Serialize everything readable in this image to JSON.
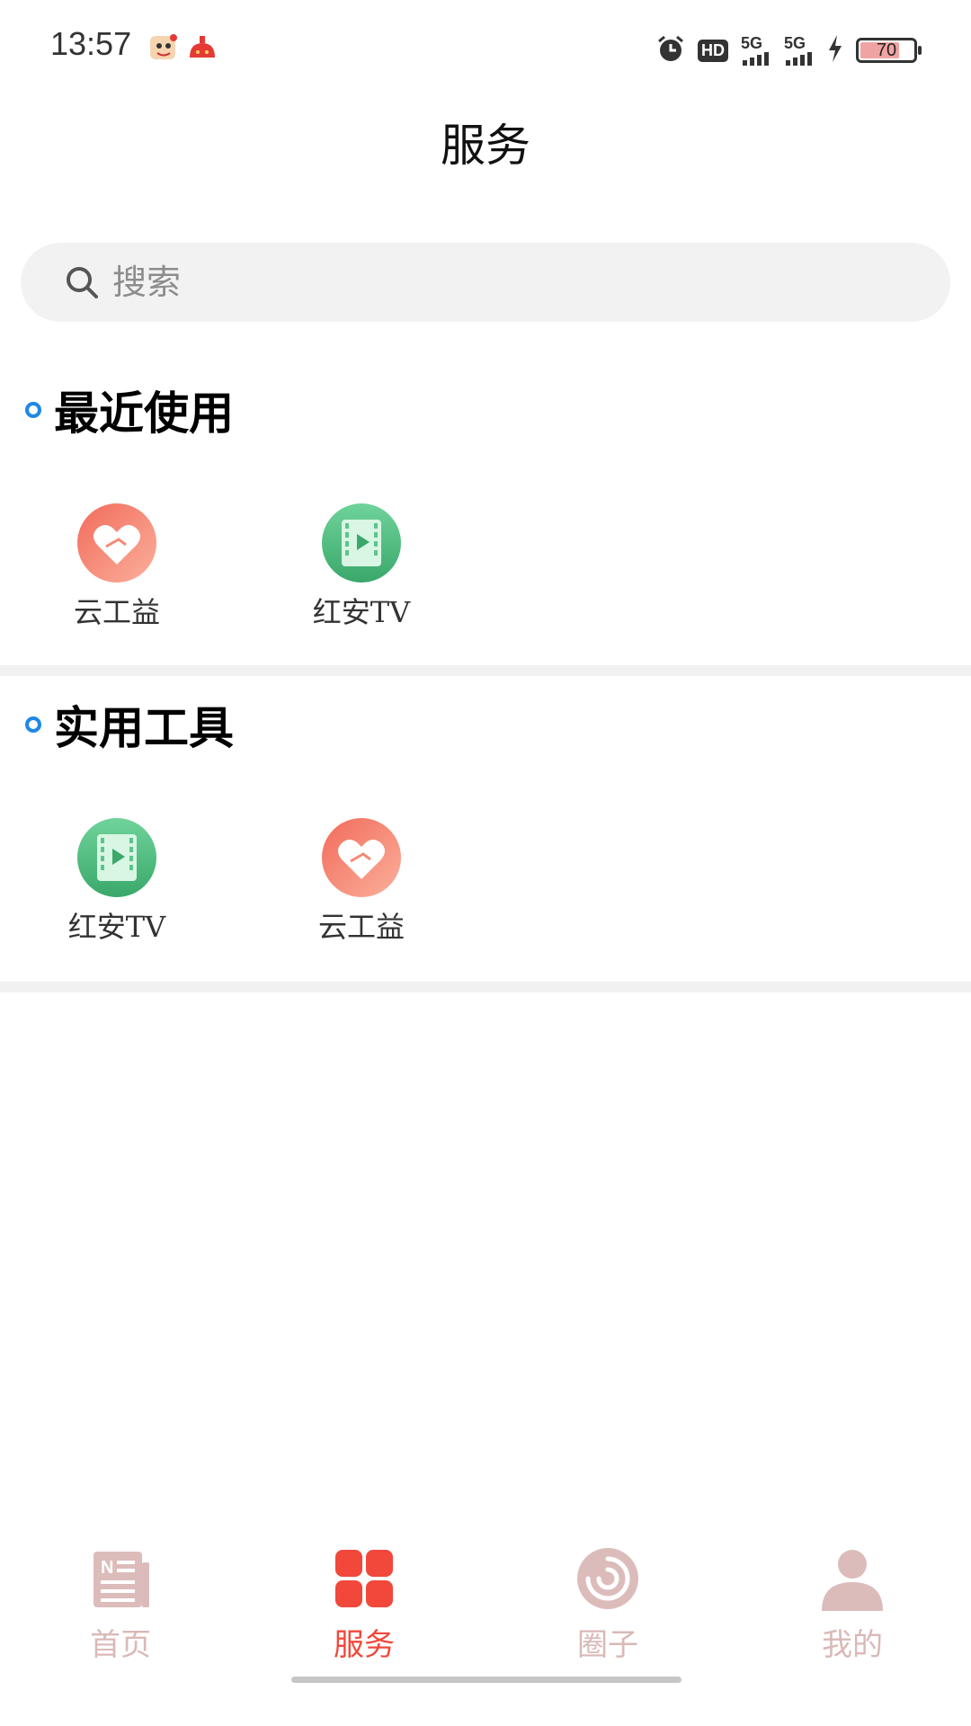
{
  "status_bar": {
    "time": "13:57",
    "hd_label": "HD",
    "sim1": "5G",
    "sim2": "5G",
    "battery": "70"
  },
  "page_title": "服务",
  "search": {
    "placeholder": "搜索"
  },
  "sections": [
    {
      "title": "最近使用",
      "apps": [
        {
          "label": "云工益",
          "icon": "heart-hand-icon"
        },
        {
          "label": "红安TV",
          "icon": "video-play-icon"
        }
      ]
    },
    {
      "title": "实用工具",
      "apps": [
        {
          "label": "红安TV",
          "icon": "video-play-icon"
        },
        {
          "label": "云工益",
          "icon": "heart-hand-icon"
        }
      ]
    }
  ],
  "nav": {
    "items": [
      {
        "label": "首页",
        "icon": "news-icon"
      },
      {
        "label": "服务",
        "icon": "grid-icon"
      },
      {
        "label": "圈子",
        "icon": "circle-swirl-icon"
      },
      {
        "label": "我的",
        "icon": "user-icon"
      }
    ],
    "active": 1
  },
  "colors": {
    "accent": "#f1483b",
    "inactive": "#d9b9b7",
    "section_dot": "#1e88e5",
    "heart_icon": "#f48a78",
    "video_icon": "#5bc58c"
  }
}
